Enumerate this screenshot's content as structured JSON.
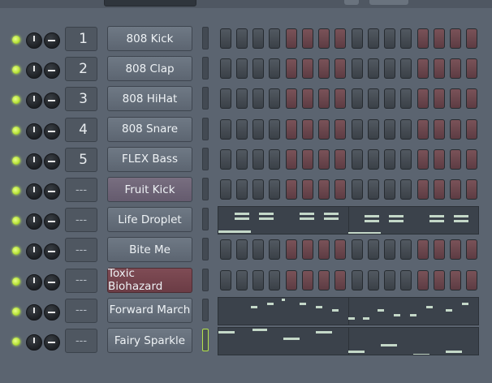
{
  "channels": [
    {
      "num": "1",
      "name": "808 Kick",
      "pattern": "steps",
      "tone": "normal"
    },
    {
      "num": "2",
      "name": "808 Clap",
      "pattern": "steps",
      "tone": "normal"
    },
    {
      "num": "3",
      "name": "808 HiHat",
      "pattern": "steps",
      "tone": "normal"
    },
    {
      "num": "4",
      "name": "808 Snare",
      "pattern": "steps",
      "tone": "normal"
    },
    {
      "num": "5",
      "name": "FLEX Bass",
      "pattern": "steps",
      "tone": "normal"
    },
    {
      "num": "---",
      "name": "Fruit Kick",
      "pattern": "steps",
      "tone": "purple"
    },
    {
      "num": "---",
      "name": "Life Droplet",
      "pattern": "roll",
      "tone": "normal"
    },
    {
      "num": "---",
      "name": "Bite Me",
      "pattern": "steps",
      "tone": "normal"
    },
    {
      "num": "---",
      "name": "Toxic Biohazard",
      "pattern": "steps",
      "tone": "red"
    },
    {
      "num": "---",
      "name": "Forward March",
      "pattern": "roll",
      "tone": "normal"
    },
    {
      "num": "---",
      "name": "Fairy Sparkle",
      "pattern": "roll",
      "tone": "normal",
      "selected": true
    }
  ],
  "step_groups": [
    "grey",
    "grey",
    "grey",
    "grey",
    "red",
    "red",
    "red",
    "red",
    "grey",
    "grey",
    "grey",
    "grey",
    "red",
    "red",
    "red",
    "red"
  ],
  "colors": {
    "led": "#b8e33a",
    "step_grey": "#474e56",
    "step_red": "#6b4650",
    "background": "#5b6470"
  }
}
